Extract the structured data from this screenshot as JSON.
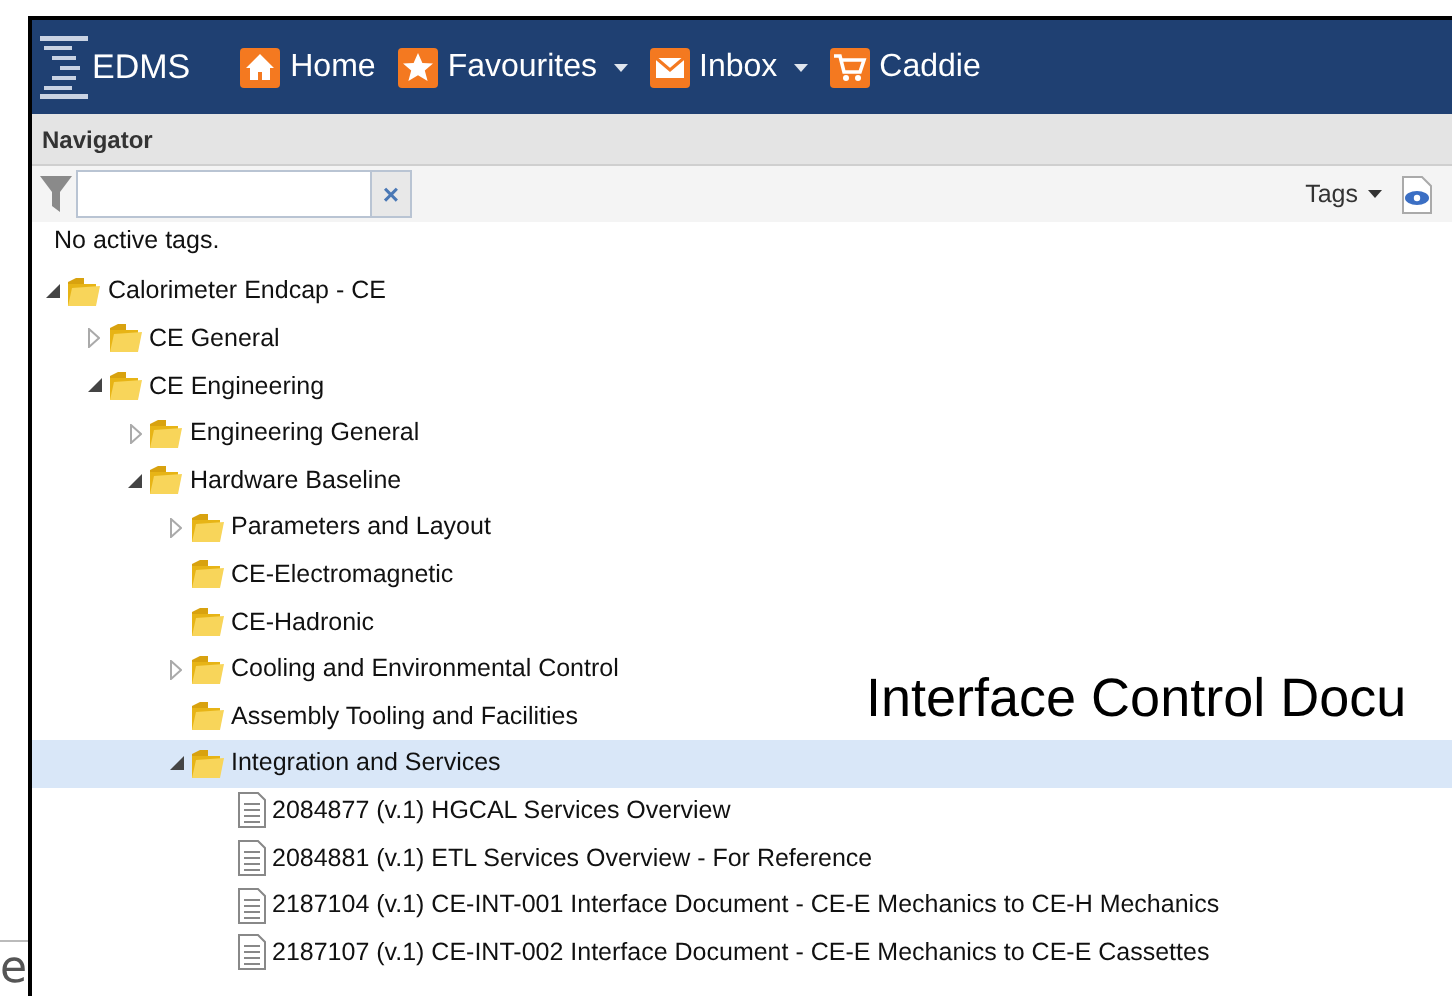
{
  "header": {
    "logo_text": "EDMS",
    "nav": [
      {
        "label": "Home",
        "kind": "home",
        "dropdown": false
      },
      {
        "label": "Favourites",
        "kind": "star",
        "dropdown": true
      },
      {
        "label": "Inbox",
        "kind": "mail",
        "dropdown": true
      },
      {
        "label": "Caddie",
        "kind": "cart",
        "dropdown": false
      }
    ]
  },
  "navigator": {
    "title": "Navigator",
    "filter": {
      "clear": "×"
    },
    "tags_menu": "Tags",
    "tags_status": "No active tags."
  },
  "tree": [
    {
      "label": "Calorimeter Endcap - CE",
      "kind": "folder",
      "expanded": true,
      "selected": false,
      "children": [
        {
          "label": "CE General",
          "kind": "folder",
          "expanded": false,
          "selected": false
        },
        {
          "label": "CE Engineering",
          "kind": "folder",
          "expanded": true,
          "selected": false,
          "children": [
            {
              "label": "Engineering General",
              "kind": "folder",
              "expanded": false,
              "selected": false
            },
            {
              "label": "Hardware Baseline",
              "kind": "folder",
              "expanded": true,
              "selected": false,
              "children": [
                {
                  "label": "Parameters and Layout",
                  "kind": "folder",
                  "expanded": false,
                  "selected": false
                },
                {
                  "label": "CE-Electromagnetic",
                  "kind": "folder",
                  "selected": false
                },
                {
                  "label": "CE-Hadronic",
                  "kind": "folder",
                  "selected": false
                },
                {
                  "label": "Cooling and Environmental Control",
                  "kind": "folder",
                  "expanded": false,
                  "selected": false
                },
                {
                  "label": "Assembly Tooling and Facilities",
                  "kind": "folder",
                  "selected": false
                },
                {
                  "label": "Integration and Services",
                  "kind": "folder",
                  "expanded": true,
                  "selected": true,
                  "children": [
                    {
                      "label": "2084877 (v.1) HGCAL Services Overview",
                      "kind": "document",
                      "selected": false
                    },
                    {
                      "label": "2084881 (v.1) ETL Services Overview - For Reference",
                      "kind": "document",
                      "selected": false
                    },
                    {
                      "label": "2187104 (v.1) CE-INT-001 Interface Document - CE-E Mechanics to CE-H Mechanics",
                      "kind": "document",
                      "selected": false
                    },
                    {
                      "label": "2187107 (v.1) CE-INT-002 Interface Document - CE-E Mechanics to CE-E Cassettes",
                      "kind": "document",
                      "selected": false
                    }
                  ]
                }
              ]
            }
          ]
        }
      ]
    }
  ],
  "slide": {
    "heading": "Interface Control Docu",
    "edge_letter": "e"
  }
}
